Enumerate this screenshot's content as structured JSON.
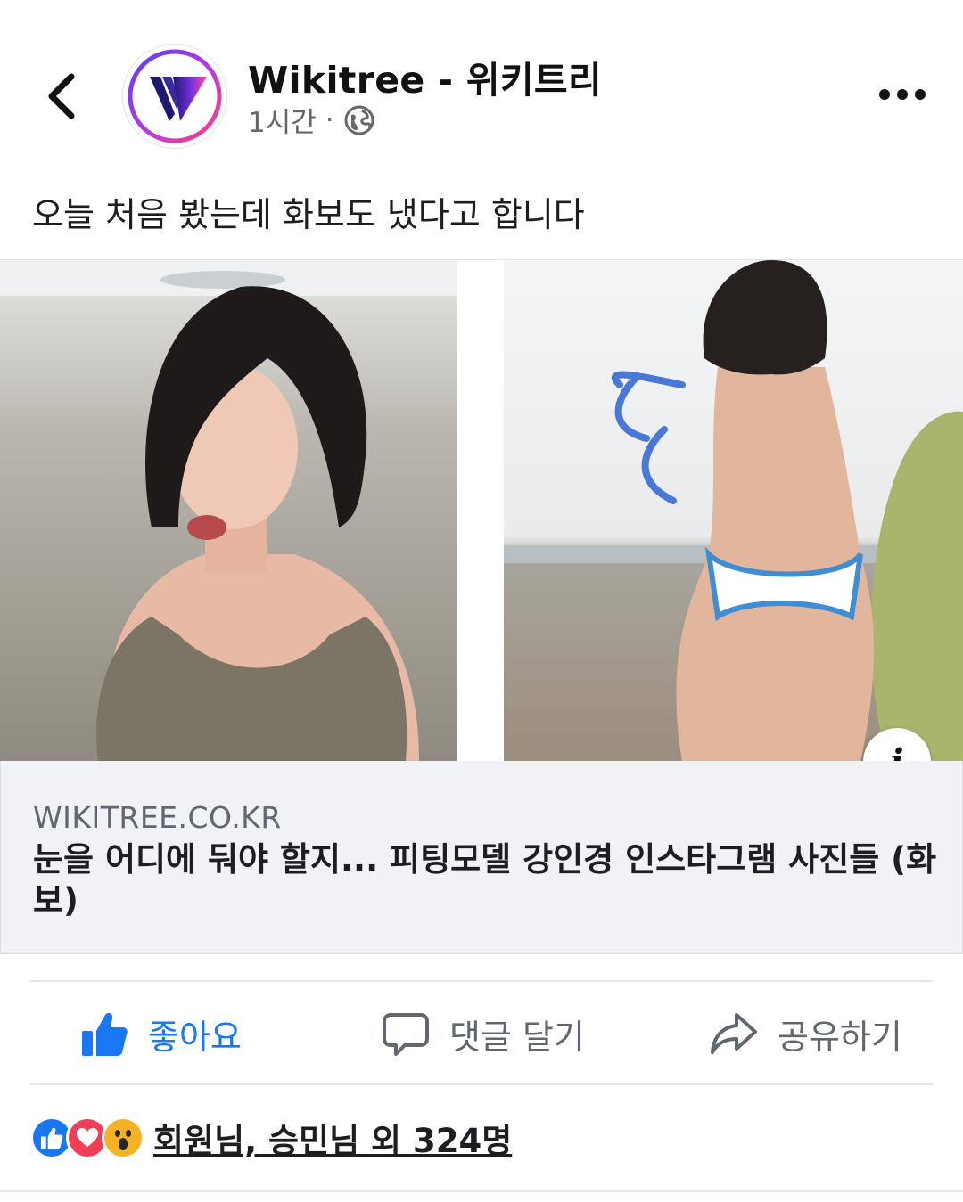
{
  "post": {
    "page_name": "Wikitree - 위키트리",
    "time": "1시간",
    "separator": "·",
    "privacy_icon": "globe-icon",
    "caption": "오늘 처음 봤는데 화보도 냈다고 합니다"
  },
  "link_card": {
    "domain": "WIKITREE.CO.KR",
    "title": "눈을 어디에 둬야 할지... 피팅모델 강인경 인스타그램 사진들 (화보)",
    "info_icon": "i"
  },
  "actions": {
    "like_label": "좋아요",
    "comment_label": "댓글 달기",
    "share_label": "공유하기"
  },
  "reactions": {
    "icons": [
      "like-reaction-icon",
      "love-reaction-icon",
      "wow-reaction-icon"
    ],
    "summary": "회원님, 승민님 외 324명"
  },
  "colors": {
    "accent": "#1877f2",
    "muted_text": "#65676b",
    "card_bg": "#f0f2f5",
    "love": "#f33e58",
    "wow": "#f7b125"
  }
}
